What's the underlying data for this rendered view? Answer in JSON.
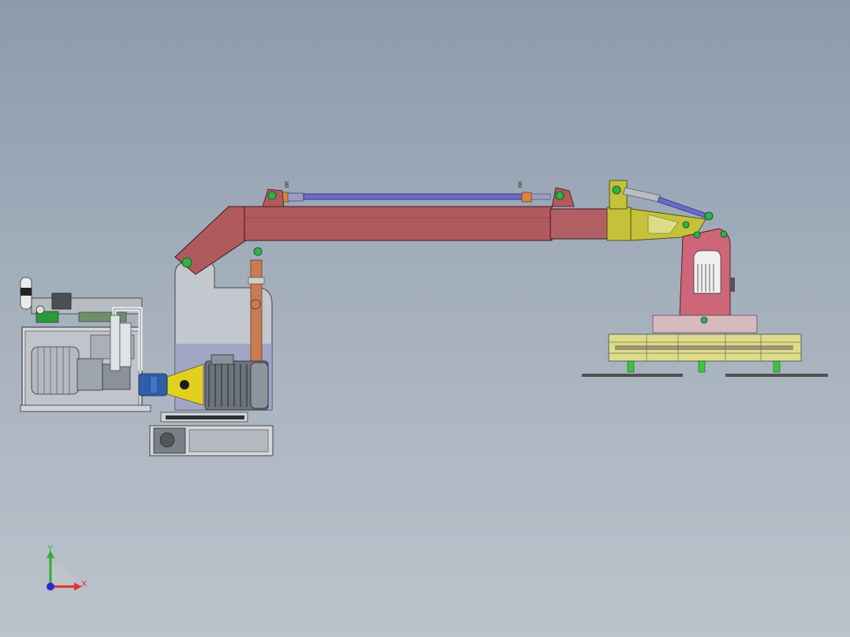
{
  "viewport": {
    "background_top": "#8c9aab",
    "background_bottom": "#bcc3cc"
  },
  "model": {
    "parts": {
      "boom": "#b05a5e",
      "arm_link": "#cc6678",
      "pivot": "#2db34a",
      "frame_yellow": "#c4c23a",
      "gripper_frame": "#d8d88a",
      "hydraulic_cylinder": "#6a6ac8",
      "column": "#c87850",
      "motor": "#6f7780",
      "coupling": "#e2d020",
      "pump": "#2f5fa8",
      "tank": "#cfd4da",
      "suction_pad": "#3ec43e"
    },
    "cylinder_tag": "6K"
  },
  "triad": {
    "x_label": "X",
    "y_label": "Y",
    "x_color": "#e03030",
    "y_color": "#2fb02f",
    "z_color": "#2a2ad0"
  }
}
